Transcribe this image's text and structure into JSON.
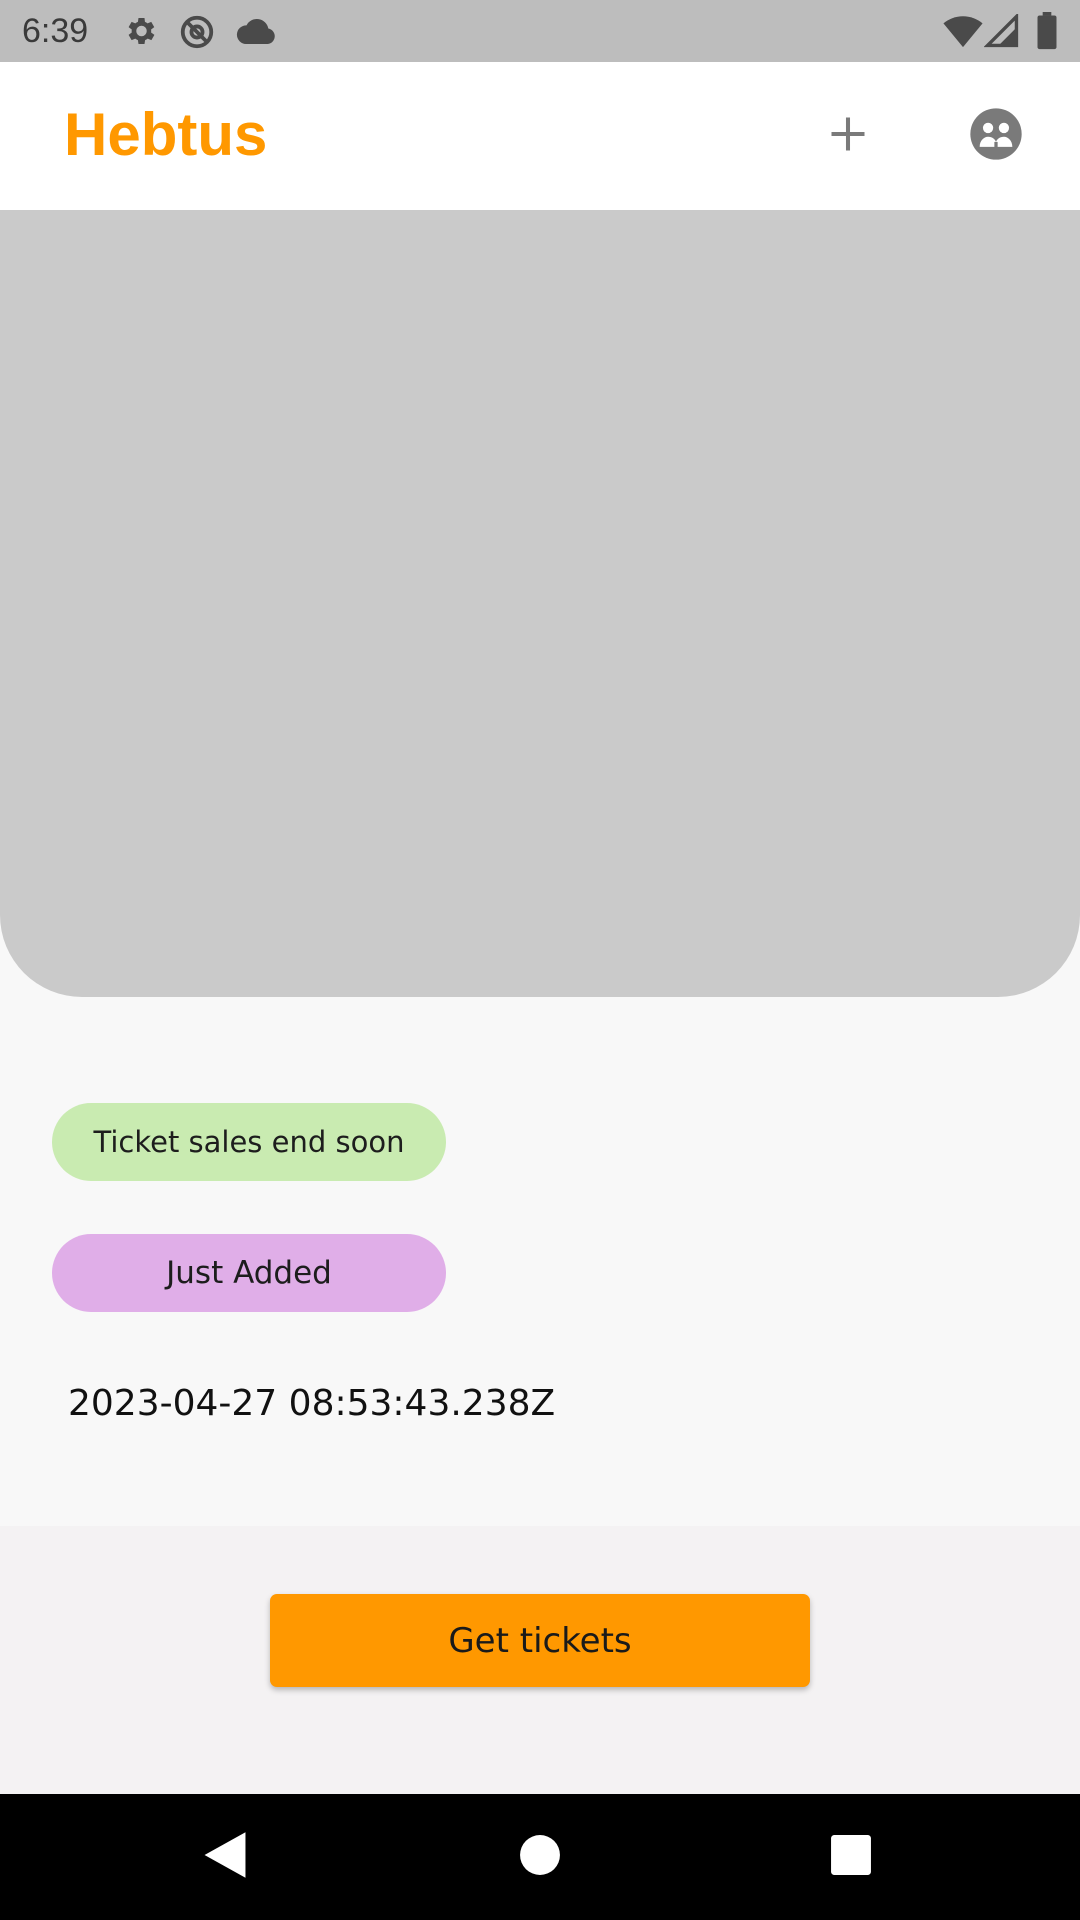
{
  "status_bar": {
    "time": "6:39",
    "left_icons": [
      "gear-icon",
      "at-sign-icon",
      "cloud-icon"
    ],
    "right_icons": [
      "wifi-icon",
      "signal-icon",
      "battery-icon"
    ]
  },
  "app_bar": {
    "title": "Hebtus",
    "actions": [
      "add-icon",
      "account-group-icon"
    ]
  },
  "event": {
    "badges": [
      {
        "label": "Ticket sales end soon",
        "color": "#c9ebb1"
      },
      {
        "label": "Just Added",
        "color": "#e0aee8"
      }
    ],
    "timestamp": "2023-04-27 08:53:43.238Z"
  },
  "footer": {
    "button_label": "Get tickets"
  },
  "theme": {
    "accent": "#ff9800",
    "hero_placeholder": "#cacaca"
  },
  "nav": {
    "buttons": [
      "back-icon",
      "home-icon",
      "recents-icon"
    ]
  }
}
